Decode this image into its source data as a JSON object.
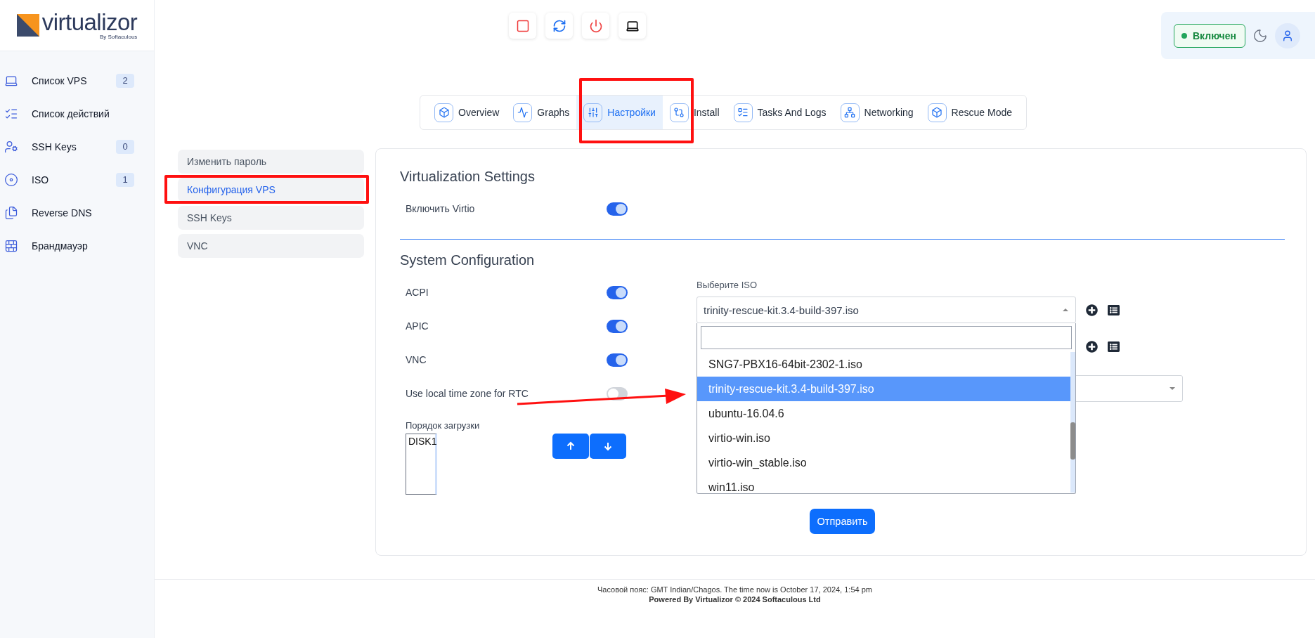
{
  "logo": {
    "name": "virtualizor",
    "tagline": "By Softaculous"
  },
  "sidebar": {
    "items": [
      {
        "kind": "laptop",
        "label": "Список VPS",
        "count": "2"
      },
      {
        "kind": "tasks",
        "label": "Список действий"
      },
      {
        "kind": "keys",
        "label": "SSH Keys",
        "count": "0"
      },
      {
        "kind": "disc",
        "label": "ISO",
        "count": "1"
      },
      {
        "kind": "dns",
        "label": "Reverse DNS"
      },
      {
        "kind": "firewall",
        "label": "Брандмауэр"
      }
    ]
  },
  "status": {
    "label": "Включен",
    "on": true
  },
  "tabs": [
    {
      "kind": "overview",
      "label": "Overview",
      "selected": false
    },
    {
      "kind": "graphs",
      "label": "Graphs",
      "selected": false
    },
    {
      "kind": "settings",
      "label": "Настройки",
      "selected": true
    },
    {
      "kind": "install",
      "label": "Install",
      "selected": false
    },
    {
      "kind": "tasks",
      "label": "Tasks And Logs",
      "selected": false
    },
    {
      "kind": "network",
      "label": "Networking",
      "selected": false
    },
    {
      "kind": "rescue",
      "label": "Rescue Mode",
      "selected": false
    }
  ],
  "settings_menu": [
    {
      "label": "Изменить пароль",
      "selected": false
    },
    {
      "label": "Конфигурация VPS",
      "selected": true
    },
    {
      "label": "SSH Keys",
      "selected": false
    },
    {
      "label": "VNC",
      "selected": false
    }
  ],
  "virtualization": {
    "title": "Virtualization Settings",
    "options": [
      {
        "label": "Включить Virtio",
        "on": true
      }
    ]
  },
  "system": {
    "title": "System Configuration",
    "options": [
      {
        "label": "ACPI",
        "on": true
      },
      {
        "label": "APIC",
        "on": true
      },
      {
        "label": "VNC",
        "on": true
      },
      {
        "label": "Use local time zone for RTC",
        "on": false
      }
    ],
    "boot_order": {
      "label": "Порядок загрузки",
      "items": [
        "DISK1"
      ]
    }
  },
  "iso": {
    "label": "Выберите ISO",
    "value": "trinity-rescue-kit.3.4-build-397.iso",
    "open": true,
    "options": [
      {
        "label": "SNG7-PBX16-64bit-2302-1.iso",
        "selected": false
      },
      {
        "label": "trinity-rescue-kit.3.4-build-397.iso",
        "selected": true
      },
      {
        "label": "ubuntu-16.04.6",
        "selected": false
      },
      {
        "label": "virtio-win.iso",
        "selected": false
      },
      {
        "label": "virtio-win_stable.iso",
        "selected": false
      },
      {
        "label": "win11.iso",
        "selected": false
      }
    ]
  },
  "submit": "Отправить",
  "footer": {
    "timezone": "Часовой пояс: GMT Indian/Chagos. The time now is October 17, 2024, 1:54 pm",
    "powered": "Powered By Virtualizor © 2024 Softaculous Ltd"
  }
}
